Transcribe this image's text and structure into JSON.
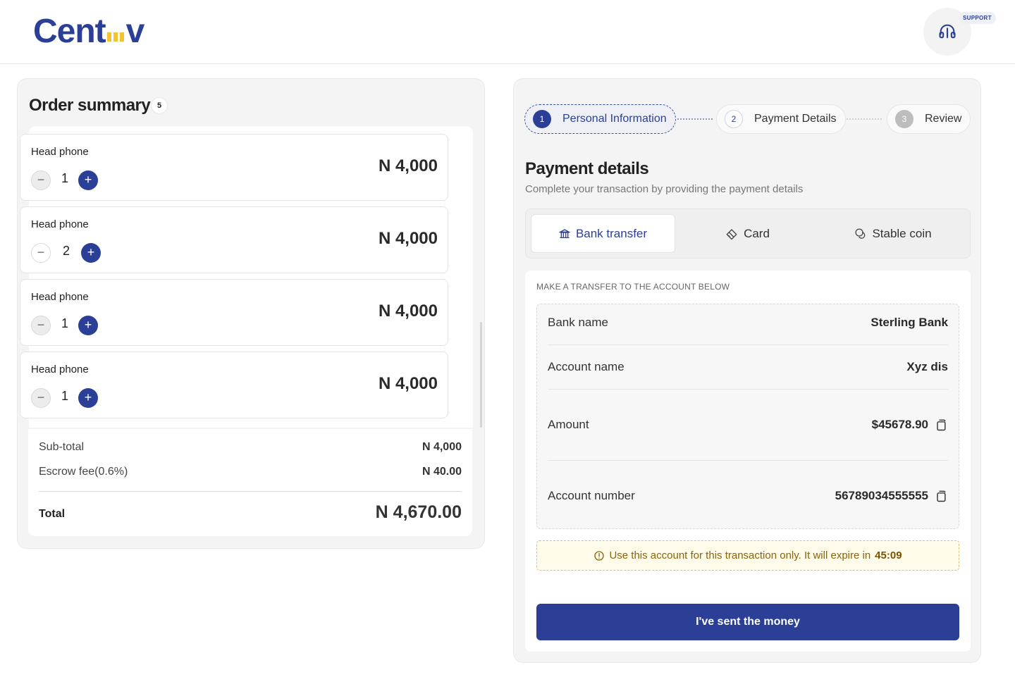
{
  "brand": {
    "logo_left": "Cent",
    "logo_right": "v",
    "accent": "#2b3f96",
    "bar_color": "#f2c230"
  },
  "header": {
    "support_label": "SUPPORT",
    "support_icon": "headset-icon"
  },
  "order": {
    "title": "Order summary",
    "count": "5",
    "items": [
      {
        "name": "Head phone",
        "qty": "1",
        "price": "N 4,000"
      },
      {
        "name": "Head phone",
        "qty": "2",
        "price": "N 4,000"
      },
      {
        "name": "Head phone",
        "qty": "1",
        "price": "N 4,000"
      },
      {
        "name": "Head phone",
        "qty": "1",
        "price": "N 4,000"
      }
    ],
    "minus_label": "−",
    "plus_label": "+",
    "subtotal_label": "Sub-total",
    "subtotal_value": "N 4,000",
    "fee_label": "Escrow fee(0.6%)",
    "fee_value": "N 40.00",
    "total_label": "Total",
    "total_value": "N 4,670.00"
  },
  "steps": [
    {
      "num": "1",
      "label": "Personal Information"
    },
    {
      "num": "2",
      "label": "Payment Details"
    },
    {
      "num": "3",
      "label": "Review"
    }
  ],
  "payment": {
    "title": "Payment details",
    "subtitle": "Complete your transaction by providing the payment details",
    "tabs": [
      {
        "label": "Bank transfer",
        "icon": "bank-icon"
      },
      {
        "label": "Card",
        "icon": "card-icon"
      },
      {
        "label": "Stable coin",
        "icon": "coin-icon"
      }
    ],
    "transfer_heading": "MAKE A TRANSFER TO THE ACCOUNT BELOW",
    "bank_name_label": "Bank name",
    "bank_name_value": "Sterling Bank",
    "account_name_label": "Account name",
    "account_name_value": "Xyz dis",
    "amount_label": "Amount",
    "amount_value": "$45678.90",
    "account_number_label": "Account number",
    "account_number_value": "56789034555555",
    "notice_text": "Use this account for this transaction only. It will expire in",
    "notice_timer": "45:09",
    "send_button": "I've sent the money"
  }
}
